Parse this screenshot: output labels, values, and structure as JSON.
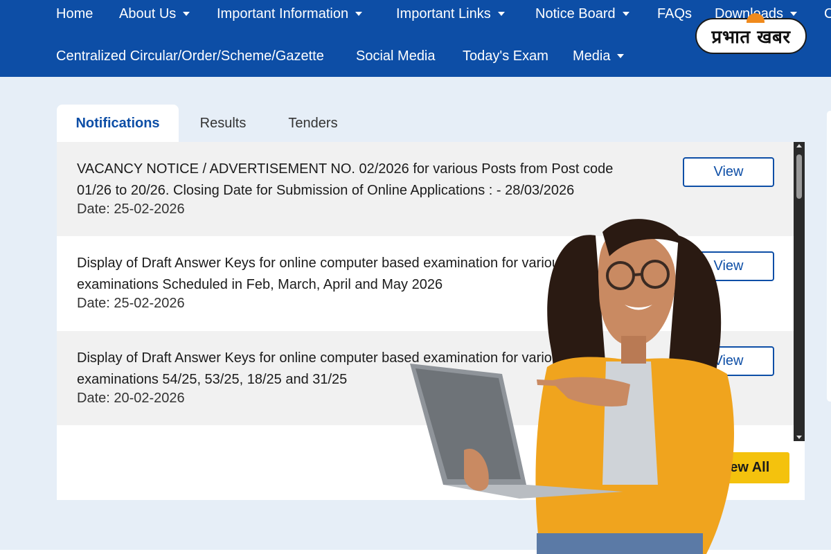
{
  "nav": {
    "row1": [
      {
        "label": "Home",
        "dropdown": false
      },
      {
        "label": "About Us",
        "dropdown": true
      },
      {
        "label": "Important Information",
        "dropdown": true
      },
      {
        "label": "Important Links",
        "dropdown": true
      },
      {
        "label": "Notice Board",
        "dropdown": true
      },
      {
        "label": "FAQs",
        "dropdown": false
      },
      {
        "label": "Downloads",
        "dropdown": true
      },
      {
        "label": "C",
        "dropdown": false
      }
    ],
    "row2": [
      {
        "label": "Centralized Circular/Order/Scheme/Gazette",
        "dropdown": false
      },
      {
        "label": "Social Media",
        "dropdown": false
      },
      {
        "label": "Today's Exam",
        "dropdown": false
      },
      {
        "label": "Media",
        "dropdown": true
      }
    ]
  },
  "brand": {
    "logo_text": "प्रभात खबर",
    "icon": "sun-icon"
  },
  "tabs": [
    {
      "label": "Notifications",
      "active": true
    },
    {
      "label": "Results",
      "active": false
    },
    {
      "label": "Tenders",
      "active": false
    }
  ],
  "notices": [
    {
      "title": "VACANCY NOTICE / ADVERTISEMENT NO. 02/2026 for various Posts from Post code 01/26 to 20/26. Closing Date for Submission of Online Applications : - 28/03/2026",
      "date": "Date: 25-02-2026",
      "button": "View"
    },
    {
      "title": "Display of Draft Answer Keys for online computer based examination for various examinations Scheduled in Feb, March, April and May 2026",
      "date": "Date: 25-02-2026",
      "button": "View"
    },
    {
      "title": "Display of Draft Answer Keys for online computer based examination for various examinations 54/25, 53/25, 18/25 and 31/25",
      "date": "Date: 20-02-2026",
      "button": "View"
    }
  ],
  "view_all": "View All",
  "colors": {
    "nav_bg": "#0d4ea6",
    "page_bg": "#e6eef7",
    "accent_blue": "#0d4ea6",
    "view_all_bg": "#f4c20d",
    "shade_row": "#f1f1f1"
  }
}
